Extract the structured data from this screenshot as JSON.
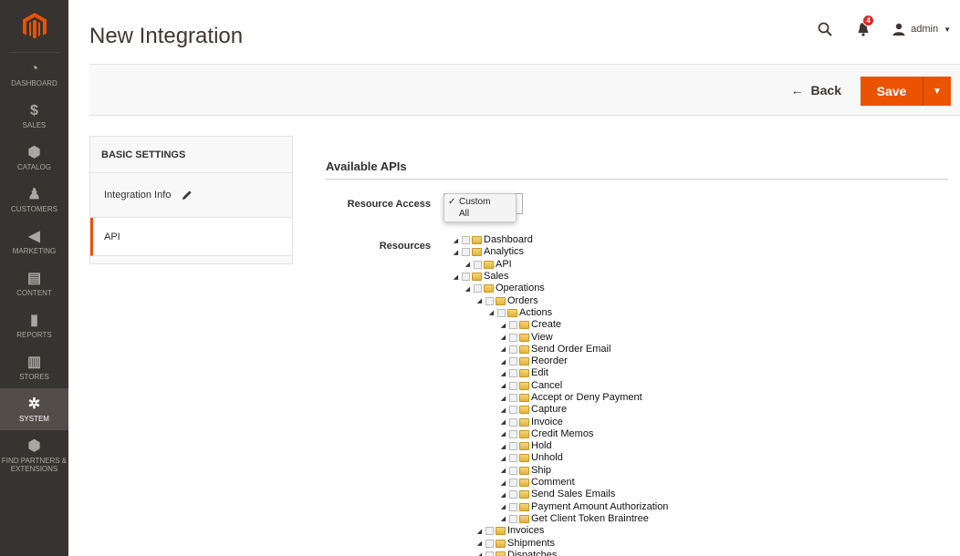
{
  "app": {
    "page_title": "New Integration"
  },
  "header": {
    "notification_count": "4",
    "user_label": "admin"
  },
  "sidebar": {
    "items": [
      {
        "label": "DASHBOARD",
        "icon": "dashboard-icon",
        "active": false
      },
      {
        "label": "SALES",
        "icon": "dollar-icon",
        "active": false
      },
      {
        "label": "CATALOG",
        "icon": "cube-icon",
        "active": false
      },
      {
        "label": "CUSTOMERS",
        "icon": "person-icon",
        "active": false
      },
      {
        "label": "MARKETING",
        "icon": "megaphone-icon",
        "active": false
      },
      {
        "label": "CONTENT",
        "icon": "layout-icon",
        "active": false
      },
      {
        "label": "REPORTS",
        "icon": "bar-chart-icon",
        "active": false
      },
      {
        "label": "STORES",
        "icon": "store-icon",
        "active": false
      },
      {
        "label": "SYSTEM",
        "icon": "gear-icon",
        "active": true
      },
      {
        "label": "FIND PARTNERS & EXTENSIONS",
        "icon": "box-icon",
        "active": false
      }
    ]
  },
  "toolbar": {
    "back_label": "Back",
    "save_label": "Save"
  },
  "tabs": {
    "title": "BASIC SETTINGS",
    "items": [
      {
        "label": "Integration Info"
      },
      {
        "label": "API"
      }
    ]
  },
  "main": {
    "section_title": "Available APIs",
    "resource_access_label": "Resource Access",
    "resources_label": "Resources",
    "resource_access_options": [
      {
        "label": "Custom",
        "selected": true
      },
      {
        "label": "All",
        "selected": false
      }
    ]
  },
  "tree": [
    {
      "label": "Dashboard",
      "depth": 0
    },
    {
      "label": "Analytics",
      "depth": 0
    },
    {
      "label": "API",
      "depth": 1
    },
    {
      "label": "Sales",
      "depth": 0
    },
    {
      "label": "Operations",
      "depth": 1
    },
    {
      "label": "Orders",
      "depth": 2
    },
    {
      "label": "Actions",
      "depth": 3
    },
    {
      "label": "Create",
      "depth": 4
    },
    {
      "label": "View",
      "depth": 4
    },
    {
      "label": "Send Order Email",
      "depth": 4
    },
    {
      "label": "Reorder",
      "depth": 4
    },
    {
      "label": "Edit",
      "depth": 4
    },
    {
      "label": "Cancel",
      "depth": 4
    },
    {
      "label": "Accept or Deny Payment",
      "depth": 4
    },
    {
      "label": "Capture",
      "depth": 4
    },
    {
      "label": "Invoice",
      "depth": 4
    },
    {
      "label": "Credit Memos",
      "depth": 4
    },
    {
      "label": "Hold",
      "depth": 4
    },
    {
      "label": "Unhold",
      "depth": 4
    },
    {
      "label": "Ship",
      "depth": 4
    },
    {
      "label": "Comment",
      "depth": 4
    },
    {
      "label": "Send Sales Emails",
      "depth": 4
    },
    {
      "label": "Payment Amount Authorization",
      "depth": 4
    },
    {
      "label": "Get Client Token Braintree",
      "depth": 4
    },
    {
      "label": "Invoices",
      "depth": 2
    },
    {
      "label": "Shipments",
      "depth": 2
    },
    {
      "label": "Dispatches",
      "depth": 2
    }
  ]
}
